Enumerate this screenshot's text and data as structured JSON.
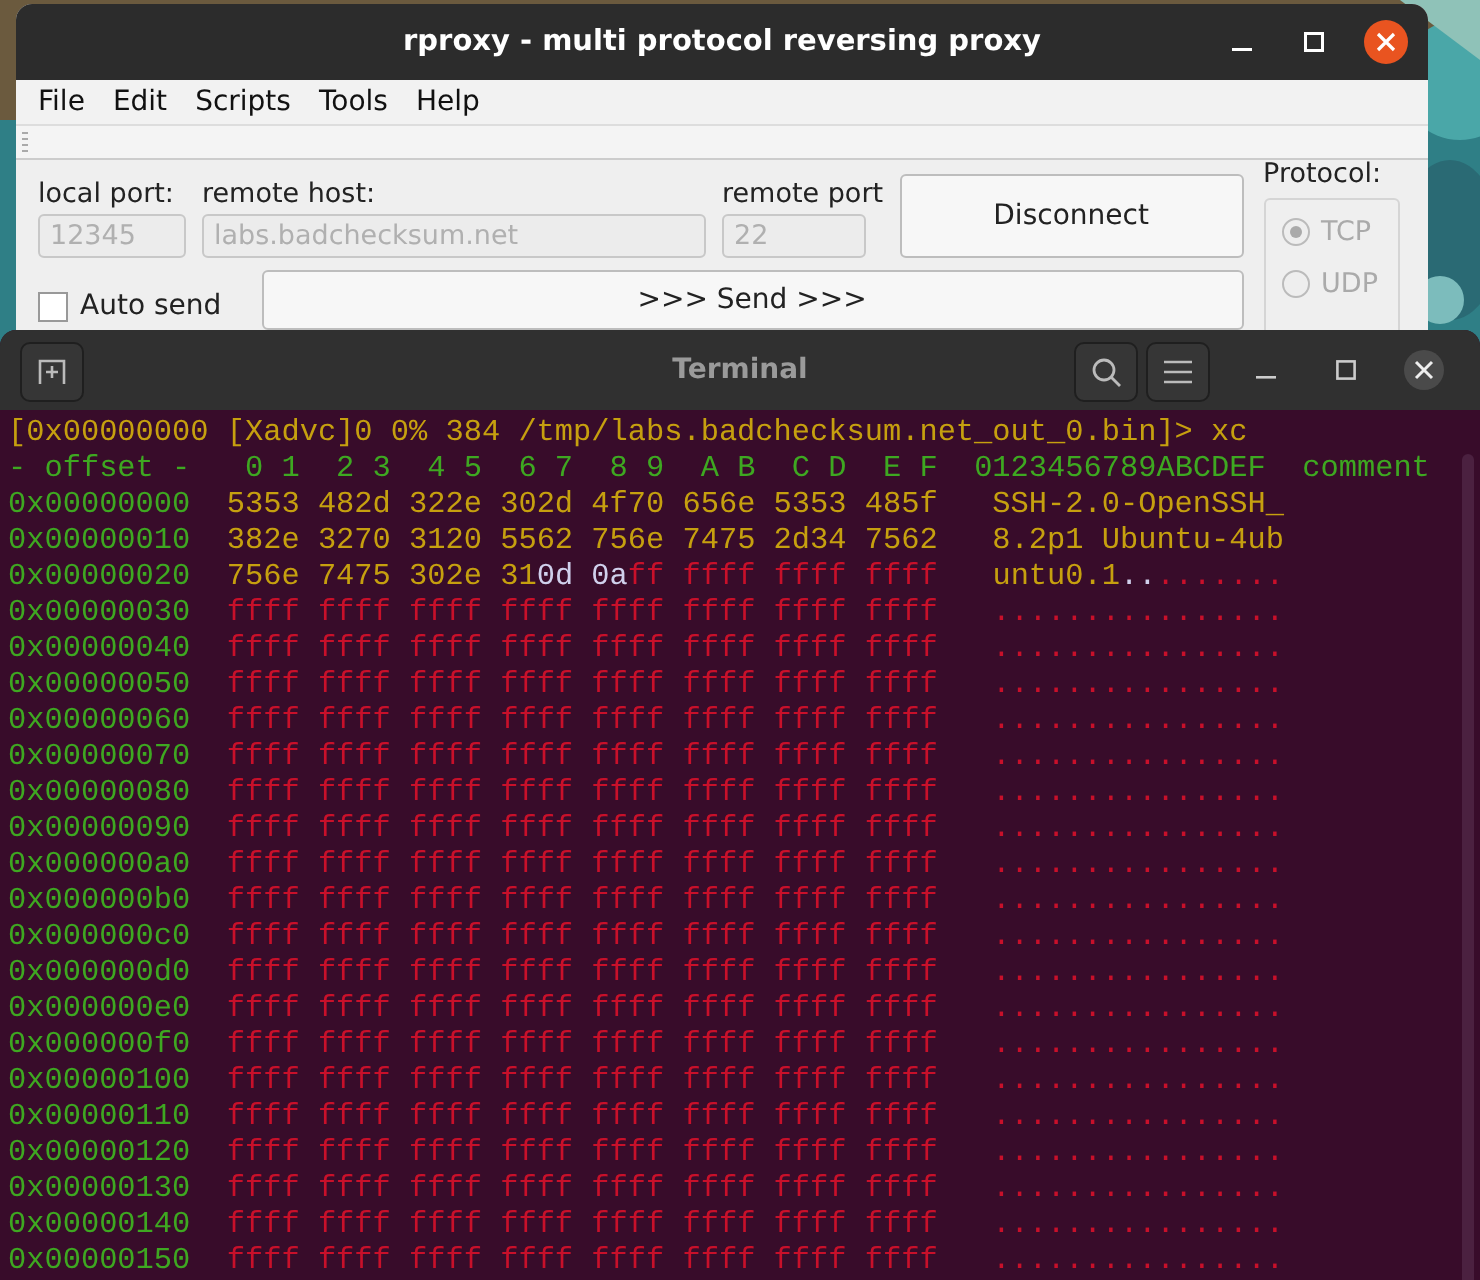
{
  "rproxy_window": {
    "title": "rproxy - multi protocol reversing proxy",
    "menu": [
      "File",
      "Edit",
      "Scripts",
      "Tools",
      "Help"
    ],
    "fields": [
      {
        "label": "local port:",
        "value": "12345",
        "disabled": true
      },
      {
        "label": "remote host:",
        "value": "labs.badchecksum.net",
        "disabled": true
      },
      {
        "label": "remote port",
        "value": "22",
        "disabled": true
      }
    ],
    "connect_button": "Disconnect",
    "auto_send": {
      "label": "Auto send",
      "checked": false
    },
    "send_button": ">>> Send >>>",
    "protocol": {
      "label": "Protocol:",
      "options": [
        {
          "label": "TCP",
          "selected": true,
          "disabled": true
        },
        {
          "label": "UDP",
          "selected": false,
          "disabled": true
        }
      ]
    }
  },
  "terminal": {
    "title": "Terminal",
    "prompt": "[0x00000000 [Xadvc]0 0% 384 /tmp/labs.badchecksum.net_out_0.bin]> xc",
    "header": {
      "offset": "- offset -",
      "hex": " 0 1  2 3  4 5  6 7  8 9  A B  C D  E F",
      "ascii": "0123456789ABCDEF",
      "comment": "comment"
    },
    "rows": [
      {
        "offset": "0x00000000",
        "hex": [
          {
            "text": "5353 482d 322e 302d 4f70 656e 5353 485f",
            "kind": "data"
          }
        ],
        "ascii": [
          {
            "text": "SSH-2.0-OpenSSH_",
            "kind": "data"
          }
        ]
      },
      {
        "offset": "0x00000010",
        "hex": [
          {
            "text": "382e 3270 3120 5562 756e 7475 2d34 7562",
            "kind": "data"
          }
        ],
        "ascii": [
          {
            "text": "8.2p1 Ubuntu-4ub",
            "kind": "data"
          }
        ]
      },
      {
        "offset": "0x00000020",
        "hex": [
          {
            "text": "756e 7475 302e 31",
            "kind": "data"
          },
          {
            "text": "0d 0a",
            "kind": "control"
          },
          {
            "text": "ff ffff ffff ffff",
            "kind": "fill"
          }
        ],
        "ascii": [
          {
            "text": "untu0.1",
            "kind": "data"
          },
          {
            "text": "..",
            "kind": "control"
          },
          {
            "text": ".......",
            "kind": "fill"
          }
        ]
      },
      {
        "offset": "0x00000030",
        "hex": [
          {
            "text": "ffff ffff ffff ffff ffff ffff ffff ffff",
            "kind": "fill"
          }
        ],
        "ascii": [
          {
            "text": "................",
            "kind": "fill"
          }
        ]
      },
      {
        "offset": "0x00000040",
        "hex": [
          {
            "text": "ffff ffff ffff ffff ffff ffff ffff ffff",
            "kind": "fill"
          }
        ],
        "ascii": [
          {
            "text": "................",
            "kind": "fill"
          }
        ]
      },
      {
        "offset": "0x00000050",
        "hex": [
          {
            "text": "ffff ffff ffff ffff ffff ffff ffff ffff",
            "kind": "fill"
          }
        ],
        "ascii": [
          {
            "text": "................",
            "kind": "fill"
          }
        ]
      },
      {
        "offset": "0x00000060",
        "hex": [
          {
            "text": "ffff ffff ffff ffff ffff ffff ffff ffff",
            "kind": "fill"
          }
        ],
        "ascii": [
          {
            "text": "................",
            "kind": "fill"
          }
        ]
      },
      {
        "offset": "0x00000070",
        "hex": [
          {
            "text": "ffff ffff ffff ffff ffff ffff ffff ffff",
            "kind": "fill"
          }
        ],
        "ascii": [
          {
            "text": "................",
            "kind": "fill"
          }
        ]
      },
      {
        "offset": "0x00000080",
        "hex": [
          {
            "text": "ffff ffff ffff ffff ffff ffff ffff ffff",
            "kind": "fill"
          }
        ],
        "ascii": [
          {
            "text": "................",
            "kind": "fill"
          }
        ]
      },
      {
        "offset": "0x00000090",
        "hex": [
          {
            "text": "ffff ffff ffff ffff ffff ffff ffff ffff",
            "kind": "fill"
          }
        ],
        "ascii": [
          {
            "text": "................",
            "kind": "fill"
          }
        ]
      },
      {
        "offset": "0x000000a0",
        "hex": [
          {
            "text": "ffff ffff ffff ffff ffff ffff ffff ffff",
            "kind": "fill"
          }
        ],
        "ascii": [
          {
            "text": "................",
            "kind": "fill"
          }
        ]
      },
      {
        "offset": "0x000000b0",
        "hex": [
          {
            "text": "ffff ffff ffff ffff ffff ffff ffff ffff",
            "kind": "fill"
          }
        ],
        "ascii": [
          {
            "text": "................",
            "kind": "fill"
          }
        ]
      },
      {
        "offset": "0x000000c0",
        "hex": [
          {
            "text": "ffff ffff ffff ffff ffff ffff ffff ffff",
            "kind": "fill"
          }
        ],
        "ascii": [
          {
            "text": "................",
            "kind": "fill"
          }
        ]
      },
      {
        "offset": "0x000000d0",
        "hex": [
          {
            "text": "ffff ffff ffff ffff ffff ffff ffff ffff",
            "kind": "fill"
          }
        ],
        "ascii": [
          {
            "text": "................",
            "kind": "fill"
          }
        ]
      },
      {
        "offset": "0x000000e0",
        "hex": [
          {
            "text": "ffff ffff ffff ffff ffff ffff ffff ffff",
            "kind": "fill"
          }
        ],
        "ascii": [
          {
            "text": "................",
            "kind": "fill"
          }
        ]
      },
      {
        "offset": "0x000000f0",
        "hex": [
          {
            "text": "ffff ffff ffff ffff ffff ffff ffff ffff",
            "kind": "fill"
          }
        ],
        "ascii": [
          {
            "text": "................",
            "kind": "fill"
          }
        ]
      },
      {
        "offset": "0x00000100",
        "hex": [
          {
            "text": "ffff ffff ffff ffff ffff ffff ffff ffff",
            "kind": "fill"
          }
        ],
        "ascii": [
          {
            "text": "................",
            "kind": "fill"
          }
        ]
      },
      {
        "offset": "0x00000110",
        "hex": [
          {
            "text": "ffff ffff ffff ffff ffff ffff ffff ffff",
            "kind": "fill"
          }
        ],
        "ascii": [
          {
            "text": "................",
            "kind": "fill"
          }
        ]
      },
      {
        "offset": "0x00000120",
        "hex": [
          {
            "text": "ffff ffff ffff ffff ffff ffff ffff ffff",
            "kind": "fill"
          }
        ],
        "ascii": [
          {
            "text": "................",
            "kind": "fill"
          }
        ]
      },
      {
        "offset": "0x00000130",
        "hex": [
          {
            "text": "ffff ffff ffff ffff ffff ffff ffff ffff",
            "kind": "fill"
          }
        ],
        "ascii": [
          {
            "text": "................",
            "kind": "fill"
          }
        ]
      },
      {
        "offset": "0x00000140",
        "hex": [
          {
            "text": "ffff ffff ffff ffff ffff ffff ffff ffff",
            "kind": "fill"
          }
        ],
        "ascii": [
          {
            "text": "................",
            "kind": "fill"
          }
        ]
      },
      {
        "offset": "0x00000150",
        "hex": [
          {
            "text": "ffff ffff ffff ffff ffff ffff ffff ffff",
            "kind": "fill"
          }
        ],
        "ascii": [
          {
            "text": "................",
            "kind": "fill"
          }
        ]
      }
    ]
  }
}
